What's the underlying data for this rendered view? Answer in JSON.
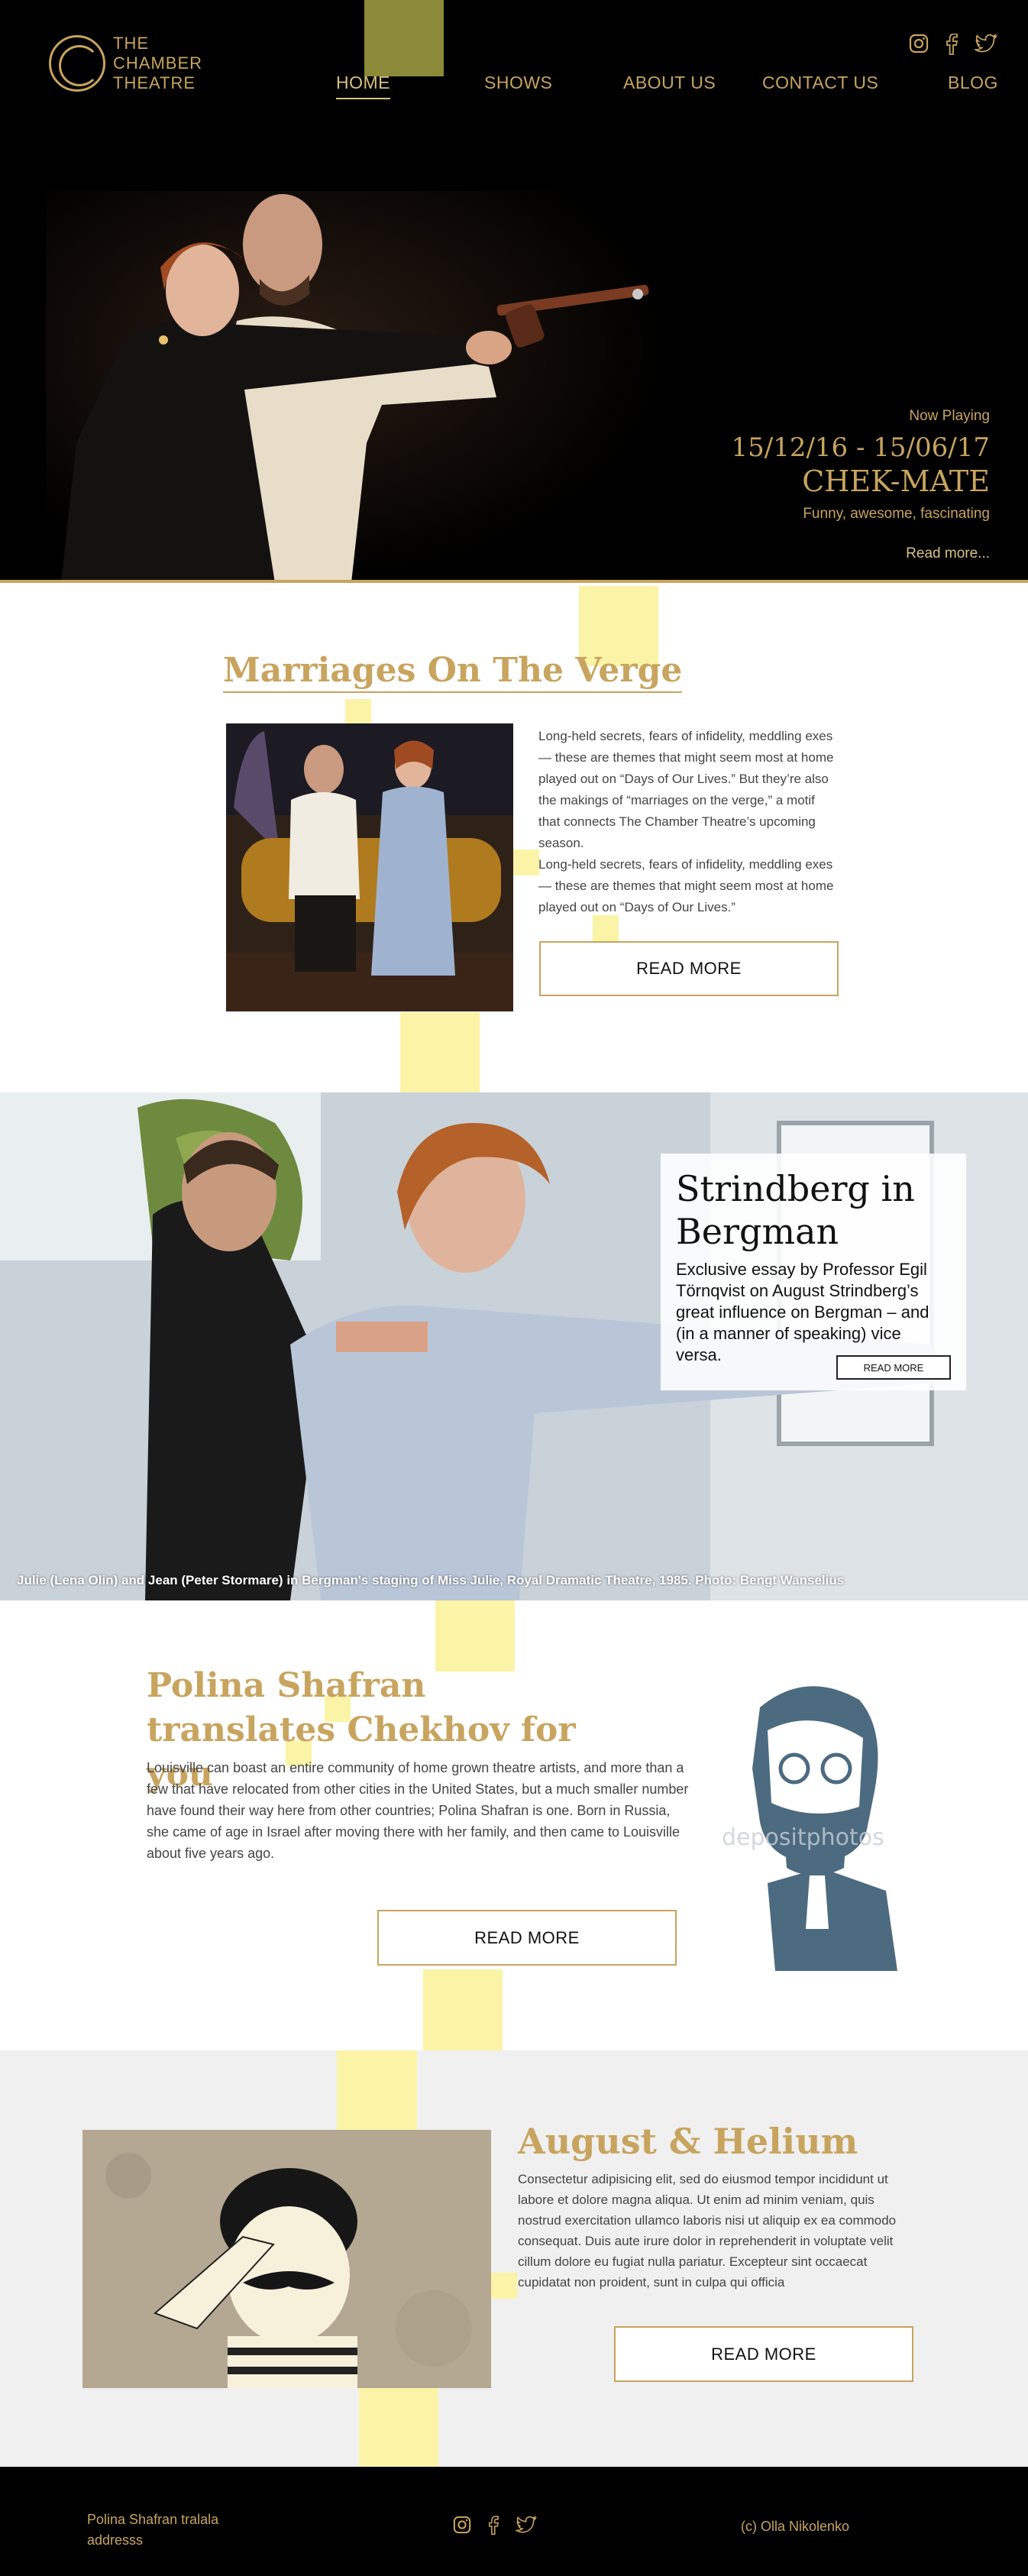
{
  "header": {
    "logo_lines": [
      "THE",
      "CHAMBER",
      "THEATRE"
    ],
    "nav": [
      {
        "label": "HOME",
        "active": true
      },
      {
        "label": "SHOWS",
        "active": false
      },
      {
        "label": "ABOUT US",
        "active": false
      },
      {
        "label": "CONTACT US",
        "active": false
      },
      {
        "label": "BLOG",
        "active": false
      }
    ],
    "social_icons": [
      "instagram-icon",
      "facebook-icon",
      "twitter-icon"
    ]
  },
  "hero": {
    "now_playing": "Now Playing",
    "dates": "15/12/16 - 15/06/17",
    "title": "CHEK-MATE",
    "tagline": "Funny, awesome, fascinating",
    "read_more": "Read more..."
  },
  "section1": {
    "title": "Marriages On The Verge",
    "text": "Long-held secrets, fears of infidelity, meddling exes — these are themes that might seem most at home played out on “Days of Our Lives.” But they’re also the makings of “marriages on the verge,” a motif that connects The Chamber Theatre’s upcoming season.\nLong-held secrets, fears of infidelity, meddling exes — these are themes that might seem most at home played out on “Days of Our Lives.”",
    "button": "READ MORE"
  },
  "section2": {
    "title": "Strindberg in Bergman",
    "text": "Exclusive essay by Professor Egil Törnqvist on August Strindberg’s great influence on Bergman – and (in a manner of speaking) vice versa.",
    "button": "READ MORE",
    "caption": "Julie (Lena Olin) and Jean (Peter Stormare)  in Bergman's staging of Miss Julie, Royal Dramatic Theatre, 1985. Photo: Bengt Wanselius"
  },
  "section3": {
    "title": "Polina Shafran translates Chekhov for you",
    "text": "Louisville can boast an entire community of home grown theatre artists, and more than a few that have relocated from other cities in the United States, but  a much smaller number have found their way here from other countries; Polina Shafran is one. Born in Russia, she came of age in Israel after moving there with her family, and then came to Louisville about five years ago.",
    "button": "READ MORE",
    "watermark": "depositphotos"
  },
  "section4": {
    "title": "August & Helium",
    "text": "Consectetur adipisicing elit, sed do eiusmod tempor incididunt ut labore et dolore magna aliqua. Ut enim ad minim veniam, quis nostrud exercitation ullamco laboris nisi ut aliquip ex ea commodo consequat. Duis aute irure dolor in reprehenderit in voluptate velit cillum dolore eu fugiat nulla pariatur. Excepteur sint occaecat cupidatat non proident, sunt in culpa qui officia",
    "button": "READ MORE"
  },
  "footer": {
    "address_line1": "Polina Shafran tralala",
    "address_line2": "addresss",
    "copyright": "(c) Olla Nikolenko"
  },
  "colors": {
    "gold": "#c8a45e",
    "black": "#000000",
    "yellow_deco": "#fbf4a6",
    "olive": "#8a8a38",
    "light_gray": "#f0f0f0"
  }
}
